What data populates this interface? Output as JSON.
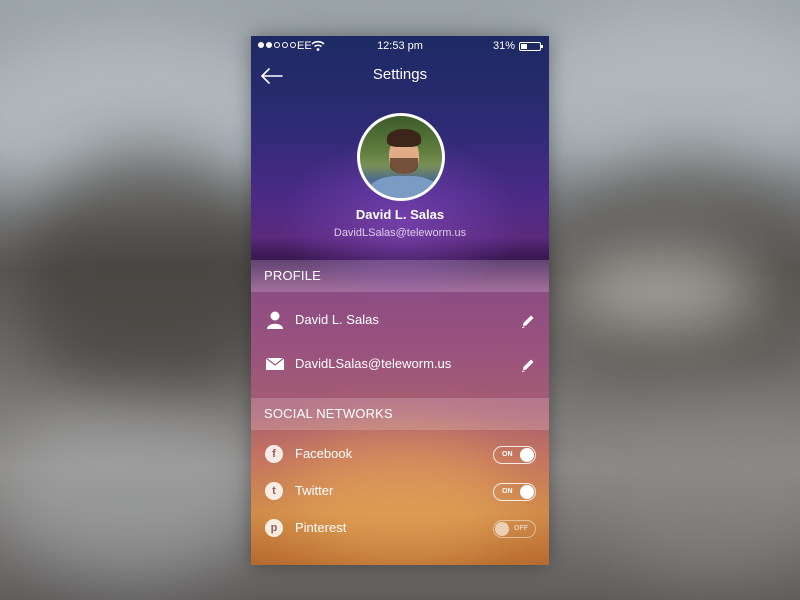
{
  "status_bar": {
    "carrier": "EE",
    "time": "12:53 pm",
    "battery": "31%"
  },
  "nav": {
    "title": "Settings"
  },
  "profile_card": {
    "name": "David L. Salas",
    "email": "DavidLSalas@teleworm.us"
  },
  "sections": {
    "profile": {
      "header": "PROFILE",
      "name_value": "David L. Salas",
      "email_value": "DavidLSalas@teleworm.us"
    },
    "social": {
      "header": "SOCIAL NETWORKS",
      "items": [
        {
          "label": "Facebook",
          "icon": "f",
          "state": "ON"
        },
        {
          "label": "Twitter",
          "icon": "t",
          "state": "ON"
        },
        {
          "label": "Pinterest",
          "icon": "p",
          "state": "OFF"
        }
      ]
    }
  }
}
